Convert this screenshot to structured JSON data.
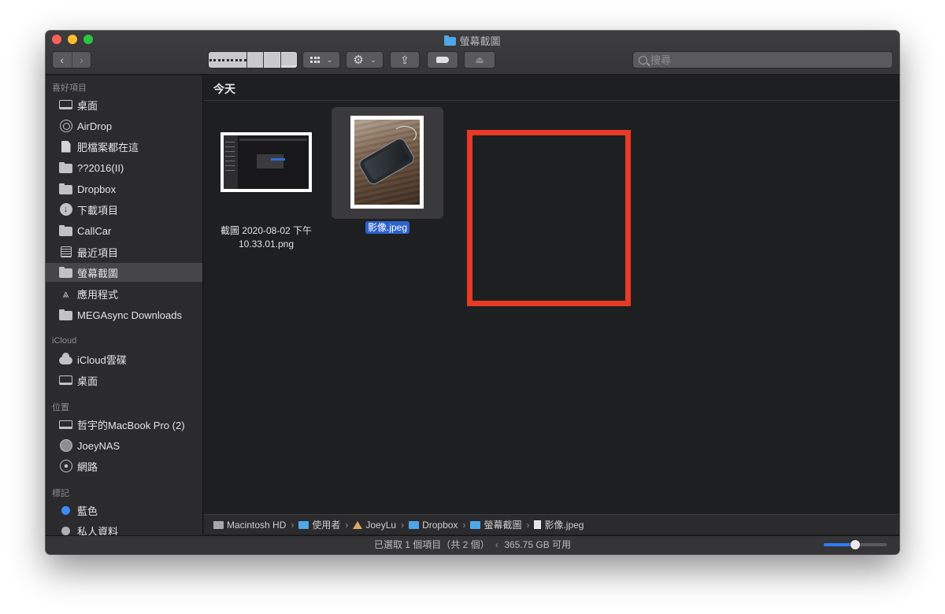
{
  "window": {
    "title": "螢幕截圖"
  },
  "toolbar": {
    "back_glyph": "‹",
    "forward_glyph": "›",
    "action_glyph": "⚙",
    "share_glyph": "⇪",
    "eject_glyph": "⏏",
    "chevron_glyph": "⌄",
    "search_placeholder": "搜尋"
  },
  "sidebar": {
    "favorites_title": "喜好項目",
    "favorites": [
      {
        "label": "桌面",
        "icon": "desktop-icon"
      },
      {
        "label": "AirDrop",
        "icon": "airdrop-icon"
      },
      {
        "label": "肥檔案都在這",
        "icon": "document-icon"
      },
      {
        "label": "??2016(II)",
        "icon": "folder-icon"
      },
      {
        "label": "Dropbox",
        "icon": "folder-icon"
      },
      {
        "label": "下載項目",
        "icon": "download-icon"
      },
      {
        "label": "CallCar",
        "icon": "folder-icon"
      },
      {
        "label": "最近項目",
        "icon": "recents-icon"
      },
      {
        "label": "螢幕截圖",
        "icon": "folder-icon",
        "selected": true
      },
      {
        "label": "應用程式",
        "icon": "applications-icon"
      },
      {
        "label": "MEGAsync Downloads",
        "icon": "folder-icon"
      }
    ],
    "icloud_title": "iCloud",
    "icloud": [
      {
        "label": "iCloud雲碟",
        "icon": "cloud-icon"
      },
      {
        "label": "桌面",
        "icon": "desktop-icon"
      }
    ],
    "locations_title": "位置",
    "locations": [
      {
        "label": "哲宇的MacBook Pro (2)",
        "icon": "laptop-icon"
      },
      {
        "label": "JoeyNAS",
        "icon": "nas-icon"
      },
      {
        "label": "網路",
        "icon": "network-icon"
      }
    ],
    "tags_title": "標記",
    "tags": [
      {
        "label": "藍色",
        "color": "#3b8cf6"
      },
      {
        "label": "私人資料",
        "color": "#b0b0b2"
      }
    ]
  },
  "content": {
    "group_title": "今天",
    "files": [
      {
        "name": "截圖 2020-08-02 下午10.33.01.png",
        "name_line1": "截圖 2020-08-02 下午",
        "name_line2": "10.33.01.png"
      },
      {
        "name": "影像.jpeg",
        "selected": true
      }
    ]
  },
  "pathbar": {
    "crumbs": [
      "Macintosh HD",
      "使用者",
      "JoeyLu",
      "Dropbox",
      "螢幕截圖",
      "影像.jpeg"
    ],
    "separator": "›"
  },
  "status": {
    "text": "已選取 1 個項目（共 2 個）",
    "space": "365.75 GB 可用",
    "divider": "‹",
    "zoom_level": 0.5
  },
  "colors": {
    "selection": "#2c62c9",
    "annotation_red": "#e63a25",
    "slider_blue": "#2f7cf6"
  }
}
